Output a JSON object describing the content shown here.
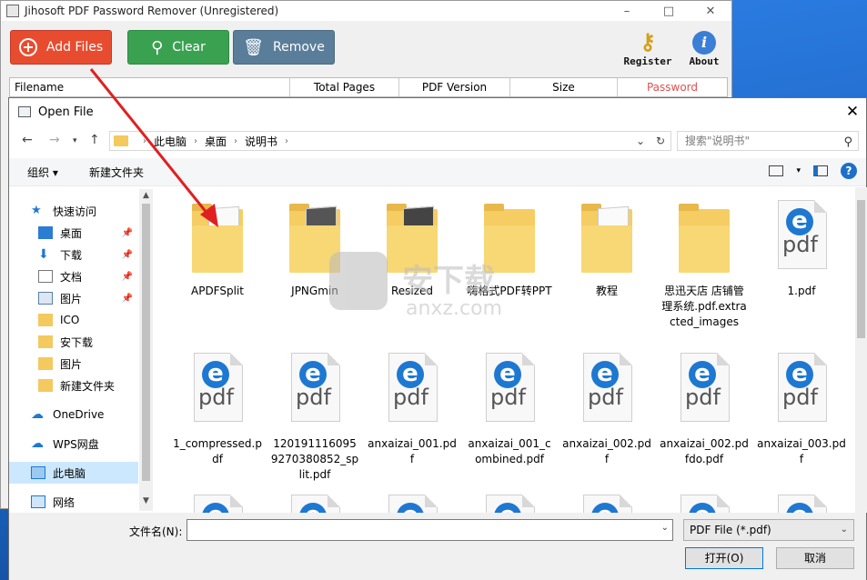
{
  "app": {
    "title": "Jihosoft PDF Password Remover (Unregistered)",
    "window_controls": [
      "–",
      "□",
      "✕"
    ],
    "toolbar": {
      "add_files": "Add Files",
      "clear": "Clear",
      "remove": "Remove",
      "register": "Register",
      "about": "About"
    },
    "columns": [
      "Filename",
      "Total Pages",
      "PDF Version",
      "Size",
      "Password"
    ],
    "password_color": "#e05050"
  },
  "dialog": {
    "title": "Open File",
    "breadcrumb": [
      "此电脑",
      "桌面",
      "说明书"
    ],
    "search_placeholder": "搜索\"说明书\"",
    "organize": "组织 ▾",
    "new_folder": "新建文件夹",
    "nav": {
      "quick_access": "快速访问",
      "items": [
        "桌面",
        "下载",
        "文档",
        "图片",
        "ICO",
        "安下载",
        "图片",
        "新建文件夹"
      ],
      "onedrive": "OneDrive",
      "wps": "WPS网盘",
      "this_pc": "此电脑",
      "network": "网络"
    },
    "files_row1": [
      {
        "name": "APDFSplit",
        "kind": "folder"
      },
      {
        "name": "JPNGmin",
        "kind": "folder"
      },
      {
        "name": "Resized",
        "kind": "folder"
      },
      {
        "name": "嗨格式PDF转PPT",
        "kind": "folder"
      },
      {
        "name": "教程",
        "kind": "folder"
      },
      {
        "name": "思迅天店 店铺管理系统.pdf.extracted_images",
        "kind": "folder"
      },
      {
        "name": "1.pdf",
        "kind": "pdf"
      }
    ],
    "files_row2": [
      {
        "name": "1_compressed.pdf",
        "kind": "pdf"
      },
      {
        "name": "1201911160959270380852_split.pdf",
        "kind": "pdf"
      },
      {
        "name": "anxaizai_001.pdf",
        "kind": "pdf"
      },
      {
        "name": "anxaizai_001_combined.pdf",
        "kind": "pdf"
      },
      {
        "name": "anxaizai_002.pdf",
        "kind": "pdf"
      },
      {
        "name": "anxaizai_002.pdfdo.pdf",
        "kind": "pdf"
      },
      {
        "name": "anxaizai_003.pdf",
        "kind": "pdf"
      }
    ],
    "filename_label": "文件名(N):",
    "filename_value": "",
    "filetype": "PDF File (*.pdf)",
    "open_button": "打开(O)",
    "cancel_button": "取消"
  },
  "watermark": {
    "cn": "安下载",
    "en": "anxz.com"
  }
}
